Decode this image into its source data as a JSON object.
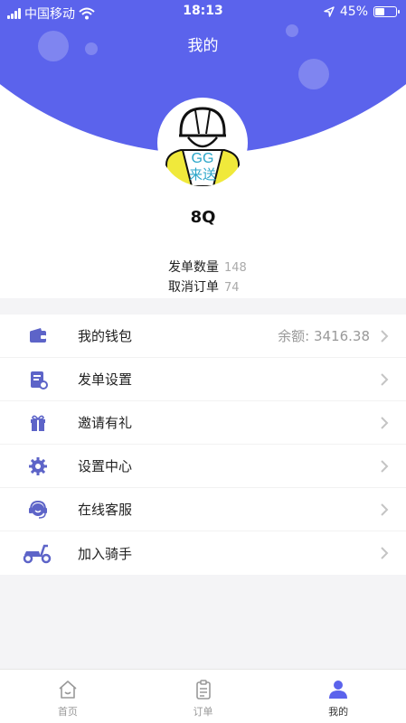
{
  "status_bar": {
    "carrier": "中国移动",
    "time": "18:13",
    "battery_text": "45%",
    "battery_level": 0.45
  },
  "header": {
    "title": "我的",
    "avatar_text": "GG",
    "avatar_subtext": "来送"
  },
  "profile": {
    "name": "8Q",
    "stats": [
      {
        "label": "发单数量",
        "value": "148"
      },
      {
        "label": "取消订单",
        "value": "74"
      }
    ]
  },
  "menu": {
    "items": [
      {
        "label": "我的钱包",
        "value": "余额: 3416.38",
        "icon": "wallet-icon"
      },
      {
        "label": "发单设置",
        "value": "",
        "icon": "order-settings-icon"
      },
      {
        "label": "邀请有礼",
        "value": "",
        "icon": "gift-icon"
      },
      {
        "label": "设置中心",
        "value": "",
        "icon": "gear-icon"
      },
      {
        "label": "在线客服",
        "value": "",
        "icon": "headset-icon"
      },
      {
        "label": "加入骑手",
        "value": "",
        "icon": "scooter-icon"
      }
    ]
  },
  "tabbar": {
    "tabs": [
      {
        "label": "首页",
        "icon": "home-icon",
        "active": false
      },
      {
        "label": "订单",
        "icon": "clipboard-icon",
        "active": false
      },
      {
        "label": "我的",
        "icon": "user-icon",
        "active": true
      }
    ]
  },
  "colors": {
    "accent": "#5b63ec",
    "icon": "#5d64c8"
  }
}
